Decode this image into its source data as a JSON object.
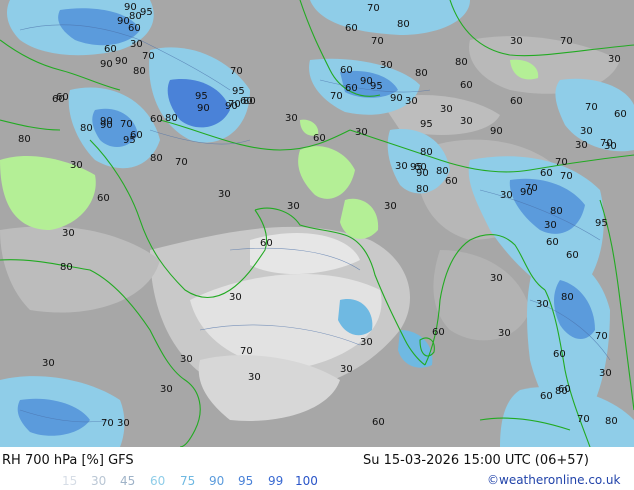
{
  "map": {
    "description_labels": [
      "90",
      "95",
      "70",
      "90",
      "80",
      "60",
      "60",
      "70",
      "70",
      "80",
      "90",
      "30",
      "60",
      "80",
      "90",
      "95",
      "60",
      "80",
      "70",
      "80",
      "60",
      "90",
      "95",
      "80",
      "60",
      "70",
      "90",
      "70",
      "95",
      "60",
      "80",
      "70",
      "30",
      "60",
      "90",
      "30",
      "80",
      "30",
      "70",
      "30",
      "80",
      "95",
      "60",
      "70",
      "90",
      "30",
      "30",
      "60",
      "90",
      "60",
      "95",
      "70",
      "30",
      "90",
      "70",
      "60",
      "30",
      "30",
      "60",
      "90",
      "30",
      "30",
      "80",
      "95",
      "60",
      "70",
      "60",
      "70",
      "30",
      "80",
      "30",
      "80",
      "30",
      "60",
      "70",
      "30",
      "60",
      "80",
      "30",
      "90",
      "95",
      "60",
      "60",
      "30",
      "30",
      "30",
      "80",
      "60",
      "80",
      "30",
      "30",
      "30",
      "30",
      "30",
      "30",
      "60",
      "30",
      "30",
      "80",
      "70",
      "60",
      "30",
      "60",
      "60",
      "70",
      "80",
      "60",
      "30",
      "30",
      "70",
      "60",
      "90",
      "30",
      "70",
      "80",
      "30"
    ]
  },
  "footer": {
    "title": "RH 700 hPa [%] GFS",
    "datetime": "Su 15-03-2026 15:00 UTC (06+57)",
    "credit": "©weatheronline.co.uk",
    "legend": [
      {
        "value": "15",
        "color": "#d6dde6"
      },
      {
        "value": "30",
        "color": "#b9c6d4"
      },
      {
        "value": "45",
        "color": "#9fb3c8"
      },
      {
        "value": "60",
        "color": "#8fcde8"
      },
      {
        "value": "75",
        "color": "#6fb9e2"
      },
      {
        "value": "90",
        "color": "#5b9bdc"
      },
      {
        "value": "95",
        "color": "#4a82d8"
      },
      {
        "value": "99",
        "color": "#3a6ad2"
      },
      {
        "value": "100",
        "color": "#2a55c8"
      }
    ]
  },
  "colors": {
    "land_grey": "#a6a6a6",
    "light_grey": "#c8c8c8",
    "very_light": "#e4e4e4",
    "green_dry": "#b4ef96",
    "blue_moist": "#6fa8dc",
    "deep_blue": "#3f6fd0",
    "coast": "#22aa22"
  }
}
